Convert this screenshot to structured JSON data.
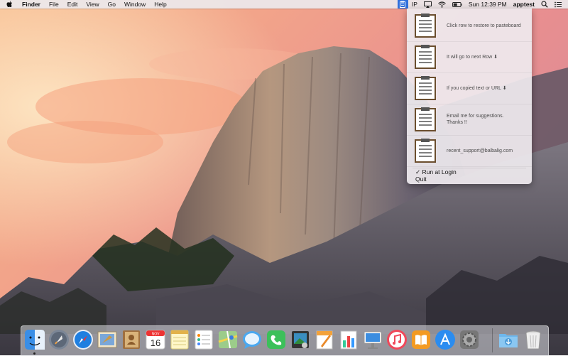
{
  "menubar": {
    "app_name": "Finder",
    "menus": [
      "File",
      "Edit",
      "View",
      "Go",
      "Window",
      "Help"
    ],
    "status": {
      "ip_label": "IP",
      "clock": "Sun 12:39 PM",
      "username": "apptest"
    }
  },
  "clipboard_menu": {
    "rows": [
      {
        "text": "Click row to restore to pasteboard"
      },
      {
        "text": "It will go to next Row ⬇"
      },
      {
        "text": "If you copied text or URL ⬇"
      },
      {
        "text": "Email me for suggestions.\nThanks !!"
      },
      {
        "text": "recent_support@balbalig.com"
      }
    ],
    "run_at_login": "✓ Run at Login",
    "quit": "Quit"
  },
  "dock": {
    "calendar_month": "NOV",
    "calendar_day": "16",
    "apps": [
      "finder-icon",
      "launchpad-icon",
      "safari-icon",
      "mail-icon",
      "contacts-icon",
      "calendar-icon",
      "notes-icon",
      "reminders-icon",
      "maps-icon",
      "messages-icon",
      "facetime-icon",
      "photo-booth-icon",
      "pages-icon",
      "numbers-icon",
      "keynote-icon",
      "itunes-icon",
      "ibooks-icon",
      "app-store-icon",
      "system-preferences-icon",
      "downloads-folder-icon",
      "trash-icon"
    ]
  },
  "colors": {
    "menubar_bg": "#ece8ec",
    "status_highlight": "#2f6fdc",
    "dock_bg": "#dcdee4"
  }
}
